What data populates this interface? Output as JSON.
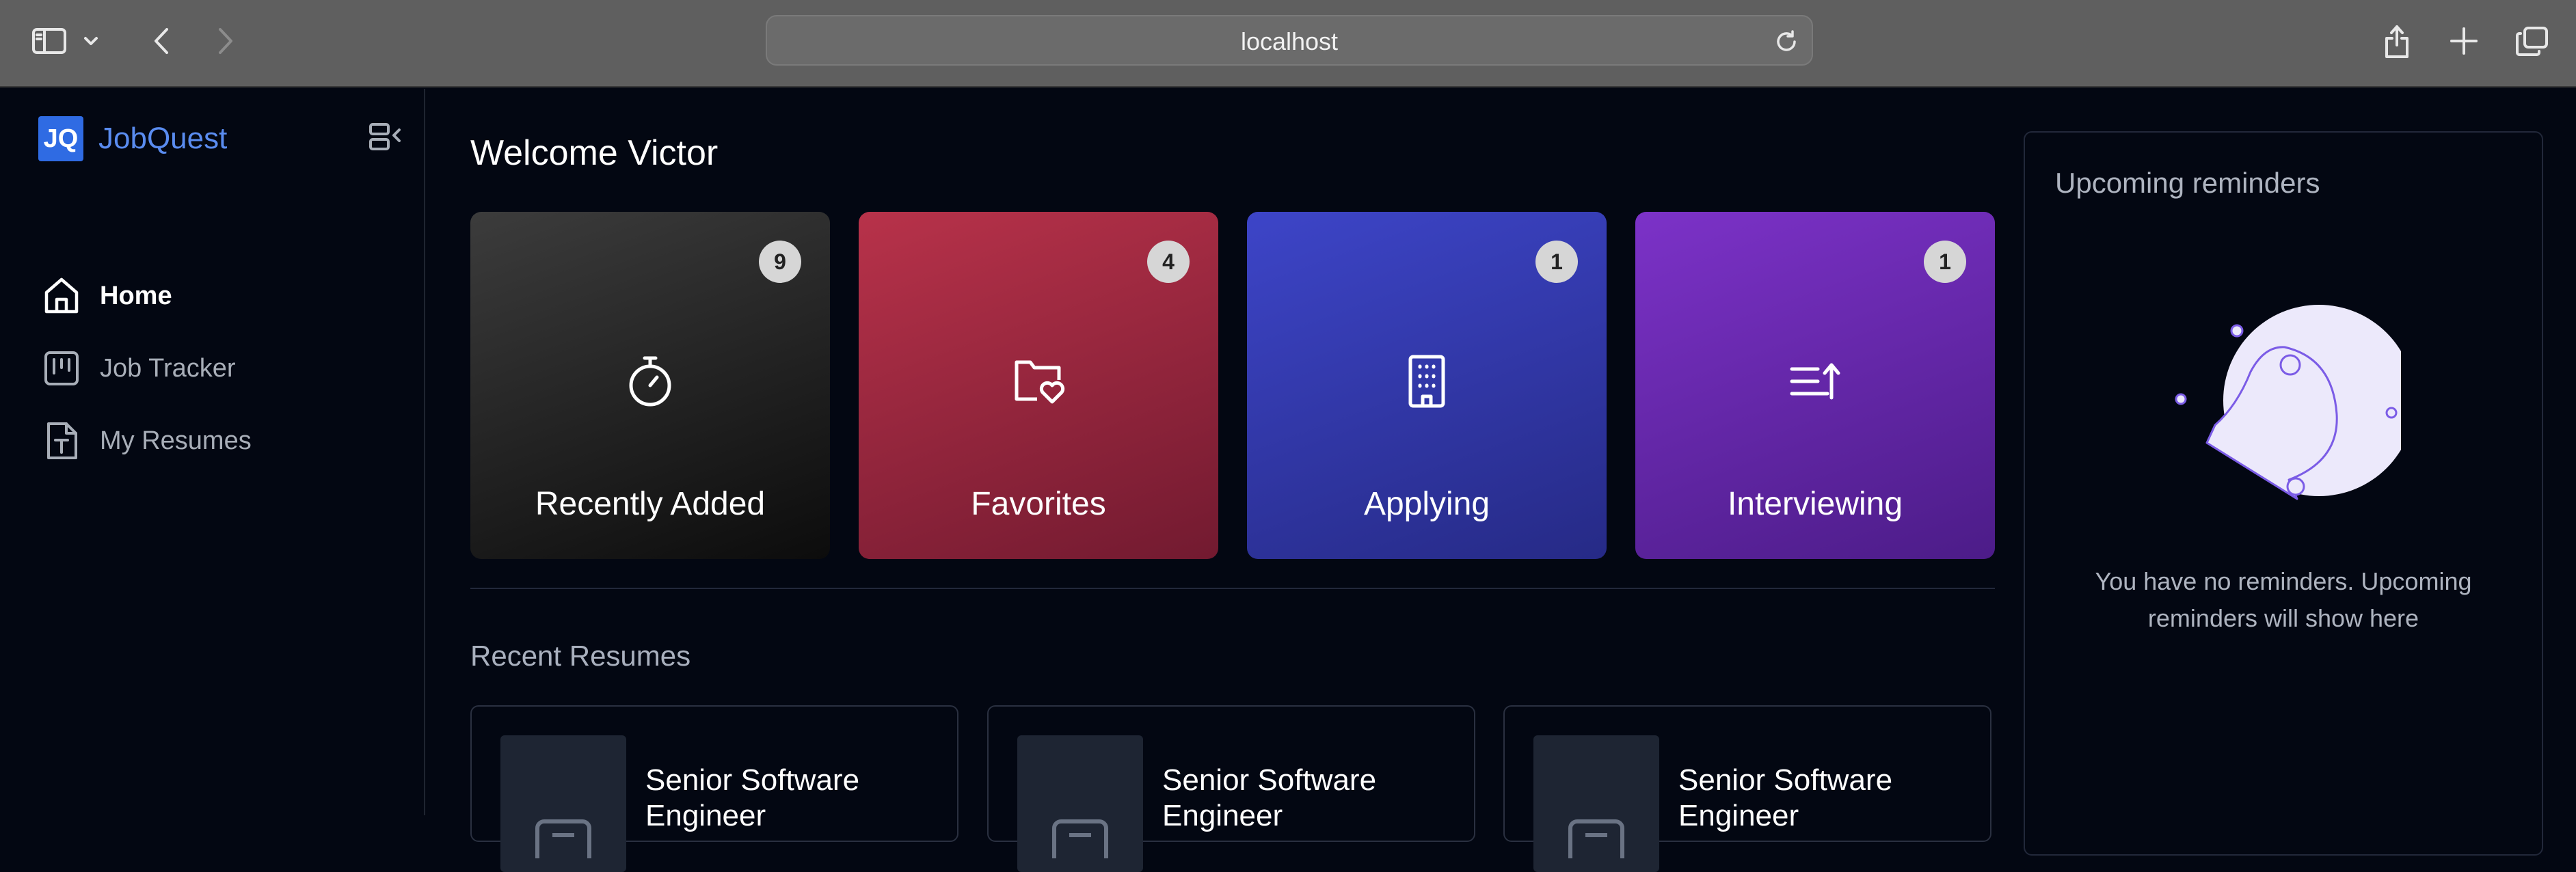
{
  "browser": {
    "url": "localhost",
    "icons": [
      "sidebar-toggle-icon",
      "chevron-down-icon",
      "back-icon",
      "forward-icon",
      "reload-icon",
      "share-icon",
      "new-tab-icon",
      "tabs-overview-icon"
    ]
  },
  "sidebar": {
    "logo_mark": "JQ",
    "logo_text": "JobQuest",
    "items": [
      {
        "label": "Home",
        "icon": "home-icon",
        "active": true
      },
      {
        "label": "Job Tracker",
        "icon": "kanban-icon",
        "active": false
      },
      {
        "label": "My Resumes",
        "icon": "document-icon",
        "active": false
      }
    ]
  },
  "main": {
    "welcome": "Welcome Victor",
    "cards": [
      {
        "title": "Recently Added",
        "count": "9",
        "icon": "stopwatch-icon",
        "color": "#2a2a2a"
      },
      {
        "title": "Favorites",
        "count": "4",
        "icon": "folder-heart-icon",
        "color": "#b8324a"
      },
      {
        "title": "Applying",
        "count": "1",
        "icon": "building-icon",
        "color": "#3d45c8"
      },
      {
        "title": "Interviewing",
        "count": "1",
        "icon": "list-arrow-icon",
        "color": "#7c32c8"
      }
    ],
    "recent_resumes_title": "Recent Resumes",
    "resumes": [
      {
        "title": "Senior Software Engineer"
      },
      {
        "title": "Senior Software Engineer"
      },
      {
        "title": "Senior Software Engineer"
      }
    ]
  },
  "reminders": {
    "title": "Upcoming reminders",
    "empty_text": "You have no reminders. Upcoming reminders will show here"
  }
}
